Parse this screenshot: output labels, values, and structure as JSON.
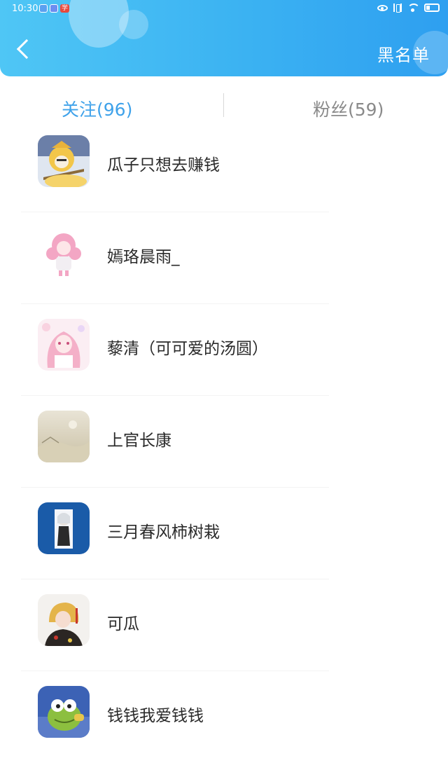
{
  "status_bar": {
    "time": "10:30",
    "app_badge": "学"
  },
  "header": {
    "blacklist_label": "黑名单"
  },
  "tabs": {
    "following": "关注(96)",
    "fans": "粉丝(59)"
  },
  "users": [
    {
      "name": "瓜子只想去赚钱",
      "avatar": "gold-armor-character-avatar"
    },
    {
      "name": "嫣珞晨雨_",
      "avatar": "pink-hair-girl-avatar"
    },
    {
      "name": "藜清（可可爱的汤圆）",
      "avatar": "pink-anime-girl-avatar"
    },
    {
      "name": "上官长康",
      "avatar": "sepia-landscape-avatar"
    },
    {
      "name": "三月春风柿树栽",
      "avatar": "white-hair-figure-avatar"
    },
    {
      "name": "可瓜",
      "avatar": "blonde-kimono-girl-avatar"
    },
    {
      "name": "钱钱我爱钱钱",
      "avatar": "green-frog-avatar"
    }
  ]
}
